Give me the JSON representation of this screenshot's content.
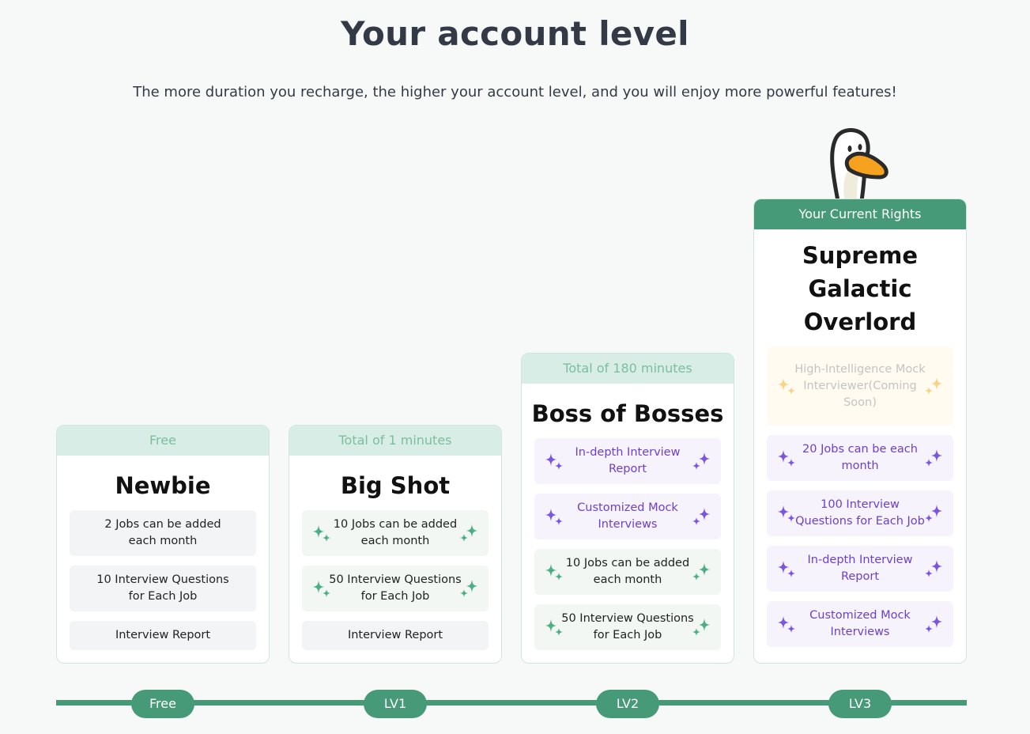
{
  "header": {
    "title": "Your account level",
    "subtitle": "The more duration you recharge, the higher your account level, and you will enjoy more powerful features!"
  },
  "colors": {
    "brand": "#469a78",
    "head_bg": "#d8ede5",
    "purple": "#7b55e0",
    "green_spark": "#4cae85",
    "gold": "#f7c15a"
  },
  "cards": [
    {
      "head": "Free",
      "name": "Newbie",
      "features": [
        "2 Jobs can be added each month",
        "10 Interview Questions for Each Job",
        "Interview Report"
      ]
    },
    {
      "head": "Total of 1 minutes",
      "name": "Big Shot",
      "features": [
        "10 Jobs can be added each month",
        "50 Interview Questions for Each Job",
        "Interview Report"
      ]
    },
    {
      "head": "Total of 180 minutes",
      "name": "Boss of Bosses",
      "features": [
        "In-depth Interview Report",
        "Customized Mock Interviews",
        "10 Jobs can be added each month",
        "50 Interview Questions for Each Job"
      ]
    },
    {
      "head": "Your Current Rights",
      "name": "Supreme Galactic Overlord",
      "features": [
        "High-Intelligence Mock Interviewer(Coming Soon)",
        "20 Jobs can be each month",
        "100 Interview Questions for Each Job",
        "In-depth Interview Report",
        "Customized Mock Interviews"
      ]
    }
  ],
  "levels": [
    "Free",
    "LV1",
    "LV2",
    "LV3"
  ],
  "icons": {
    "sparkle": "sparkle-icon",
    "mascot": "goose-mascot-icon"
  }
}
